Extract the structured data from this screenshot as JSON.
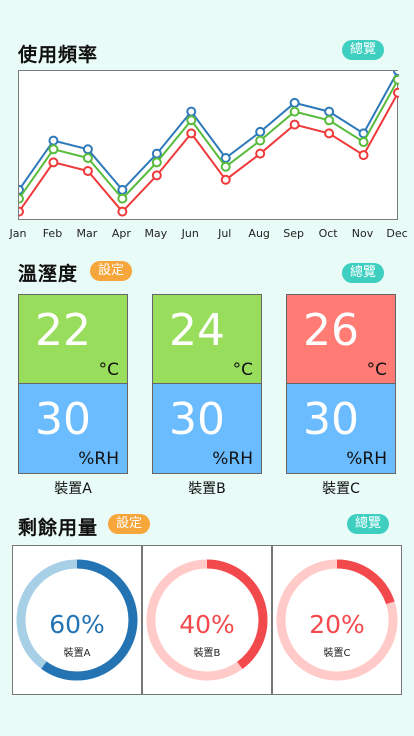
{
  "usage": {
    "title": "使用頻率",
    "overview_label": "總覽"
  },
  "chart_data": {
    "type": "line",
    "categories": [
      "Jan",
      "Feb",
      "Mar",
      "Apr",
      "May",
      "Jun",
      "Jul",
      "Aug",
      "Sep",
      "Oct",
      "Nov",
      "Dec"
    ],
    "ylim": [
      0,
      100
    ],
    "grid": false,
    "legend": "none",
    "series": [
      {
        "color": "#2e79b9",
        "values": [
          18,
          52,
          46,
          18,
          43,
          72,
          40,
          58,
          78,
          72,
          57,
          100
        ]
      },
      {
        "color": "#58bb3b",
        "values": [
          12,
          46,
          40,
          12,
          37,
          66,
          34,
          52,
          72,
          66,
          51,
          94
        ]
      },
      {
        "color": "#ee3a3a",
        "values": [
          3,
          37,
          31,
          3,
          28,
          57,
          25,
          43,
          63,
          57,
          42,
          85
        ]
      }
    ]
  },
  "climate": {
    "title": "溫溼度",
    "settings_label": "設定",
    "overview_label": "總覽",
    "devices": [
      {
        "name": "裝置A",
        "temp": "22",
        "temp_unit": "°C",
        "temp_color": "#98dd5b",
        "humidity": "30",
        "humidity_unit": "%RH"
      },
      {
        "name": "裝置B",
        "temp": "24",
        "temp_unit": "°C",
        "temp_color": "#98dd5b",
        "humidity": "30",
        "humidity_unit": "%RH"
      },
      {
        "name": "裝置C",
        "temp": "26",
        "temp_unit": "°C",
        "temp_color": "#ff7b73",
        "humidity": "30",
        "humidity_unit": "%RH"
      }
    ]
  },
  "remaining": {
    "title": "剩餘用量",
    "settings_label": "設定",
    "overview_label": "總覽",
    "devices": [
      {
        "name": "裝置A",
        "percent_label": "60%",
        "fraction": 0.6,
        "color": "#2474b4",
        "track_color": "#a7cfe6"
      },
      {
        "name": "裝置B",
        "percent_label": "40%",
        "fraction": 0.4,
        "color": "#f2494d",
        "track_color": "#ffcac8"
      },
      {
        "name": "裝置C",
        "percent_label": "20%",
        "fraction": 0.2,
        "color": "#f2494d",
        "track_color": "#ffcac8"
      }
    ]
  }
}
